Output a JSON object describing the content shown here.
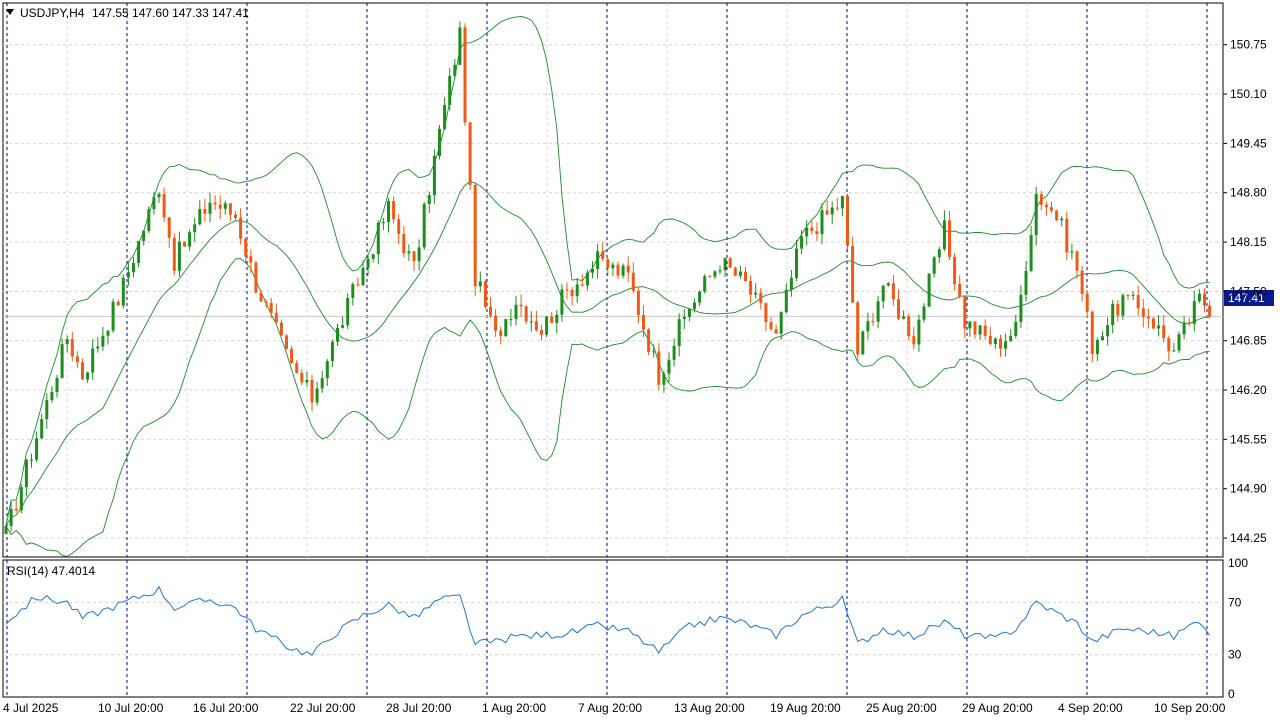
{
  "header": {
    "symbol_timeframe": "USDJPY,H4",
    "ohlc": "147.55 147.60 147.33 147.41"
  },
  "price_badge": {
    "text": "147.41",
    "bg": "#0a1a8c"
  },
  "rsi_header": "RSI(14) 47.4014",
  "colors": {
    "bull": "#1e8c1e",
    "bear": "#f05a14",
    "indicator": "#1a8c2c",
    "rsi": "#1e78c8",
    "separator": "#0000a0",
    "grid": "#d4d4d4"
  },
  "chart_data": [
    {
      "type": "line",
      "name": "USDJPY,H4 price with Bollinger Bands",
      "y_ticks": [
        "150.75",
        "150.10",
        "149.45",
        "148.80",
        "148.15",
        "147.50",
        "146.85",
        "146.20",
        "145.55",
        "144.90",
        "144.25"
      ],
      "ylim": [
        144.0,
        151.3
      ],
      "x_labels": [
        "4 Jul 2025",
        "10 Jul 20:00",
        "16 Jul 20:00",
        "22 Jul 20:00",
        "28 Jul 20:00",
        "1 Aug 20:00",
        "7 Aug 20:00",
        "13 Aug 20:00",
        "19 Aug 20:00",
        "25 Aug 20:00",
        "29 Aug 20:00",
        "4 Sep 20:00",
        "10 Sep 20:00"
      ],
      "close_path": [
        [
          0,
          144.3
        ],
        [
          6,
          145.6
        ],
        [
          12,
          146.9
        ],
        [
          15,
          146.4
        ],
        [
          22,
          147.4
        ],
        [
          30,
          148.9
        ],
        [
          33,
          147.9
        ],
        [
          40,
          148.7
        ],
        [
          45,
          148.5
        ],
        [
          49,
          147.6
        ],
        [
          56,
          146.5
        ],
        [
          60,
          146.1
        ],
        [
          64,
          146.8
        ],
        [
          70,
          147.8
        ],
        [
          75,
          148.6
        ],
        [
          80,
          147.8
        ],
        [
          85,
          149.6
        ],
        [
          89,
          150.9
        ],
        [
          92,
          147.7
        ],
        [
          96,
          146.9
        ],
        [
          100,
          147.4
        ],
        [
          105,
          147.0
        ],
        [
          110,
          147.5
        ],
        [
          116,
          147.9
        ],
        [
          122,
          147.7
        ],
        [
          128,
          146.4
        ],
        [
          134,
          147.3
        ],
        [
          140,
          147.9
        ],
        [
          145,
          147.6
        ],
        [
          151,
          146.9
        ],
        [
          156,
          148.2
        ],
        [
          164,
          148.7
        ],
        [
          167,
          146.7
        ],
        [
          172,
          147.6
        ],
        [
          178,
          146.9
        ],
        [
          184,
          148.3
        ],
        [
          188,
          147.1
        ],
        [
          194,
          146.8
        ],
        [
          198,
          147.0
        ],
        [
          202,
          148.8
        ],
        [
          206,
          148.5
        ],
        [
          210,
          147.8
        ],
        [
          213,
          146.8
        ],
        [
          219,
          147.4
        ],
        [
          224,
          147.2
        ],
        [
          229,
          146.7
        ],
        [
          234,
          147.4
        ],
        [
          236,
          147.3
        ]
      ],
      "rsi": {
        "name": "RSI(14)",
        "value": 47.4014,
        "levels": [
          30,
          70
        ],
        "ticks": [
          "100",
          "70",
          "30",
          "0"
        ],
        "ylim": [
          0,
          100
        ],
        "path": [
          [
            0,
            55
          ],
          [
            6,
            74
          ],
          [
            12,
            70
          ],
          [
            15,
            58
          ],
          [
            22,
            68
          ],
          [
            30,
            80
          ],
          [
            33,
            66
          ],
          [
            40,
            72
          ],
          [
            45,
            66
          ],
          [
            49,
            50
          ],
          [
            56,
            35
          ],
          [
            60,
            30
          ],
          [
            64,
            45
          ],
          [
            70,
            60
          ],
          [
            75,
            68
          ],
          [
            80,
            58
          ],
          [
            85,
            72
          ],
          [
            89,
            74
          ],
          [
            92,
            38
          ],
          [
            96,
            40
          ],
          [
            100,
            44
          ],
          [
            105,
            45
          ],
          [
            110,
            46
          ],
          [
            116,
            52
          ],
          [
            122,
            48
          ],
          [
            128,
            32
          ],
          [
            134,
            52
          ],
          [
            140,
            58
          ],
          [
            145,
            54
          ],
          [
            151,
            45
          ],
          [
            156,
            60
          ],
          [
            164,
            72
          ],
          [
            167,
            38
          ],
          [
            172,
            50
          ],
          [
            178,
            44
          ],
          [
            184,
            55
          ],
          [
            188,
            45
          ],
          [
            194,
            42
          ],
          [
            198,
            50
          ],
          [
            202,
            70
          ],
          [
            206,
            62
          ],
          [
            210,
            54
          ],
          [
            213,
            40
          ],
          [
            219,
            50
          ],
          [
            224,
            48
          ],
          [
            229,
            44
          ],
          [
            234,
            57
          ],
          [
            236,
            47
          ]
        ]
      }
    }
  ]
}
